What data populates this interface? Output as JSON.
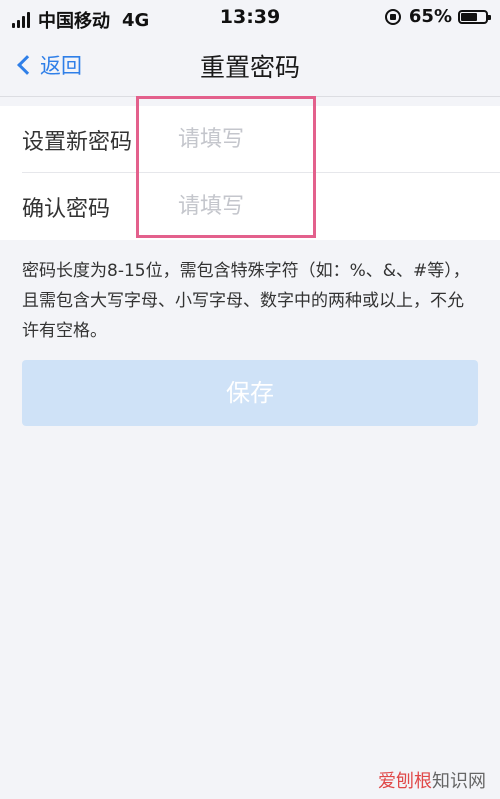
{
  "status_bar": {
    "carrier": "中国移动",
    "network": "4G",
    "time": "13:39",
    "battery_percent": "65%",
    "battery_level": 0.65,
    "rotation_icon": "rotation-lock-icon",
    "signal_icon": "signal-bars-icon"
  },
  "nav": {
    "back_label": "返回",
    "title": "重置密码",
    "back_icon": "chevron-left-icon"
  },
  "form": {
    "new_password": {
      "label": "设置新密码",
      "placeholder": "请填写",
      "value": ""
    },
    "confirm_password": {
      "label": "确认密码",
      "placeholder": "请填写",
      "value": ""
    }
  },
  "hint": "密码长度为8-15位，需包含特殊字符（如：%、&、#等），且需包含大写字母、小写字母、数字中的两种或以上，不允许有空格。",
  "save_label": "保存",
  "watermark": {
    "red_part": "爱刨根",
    "rest": "知识网"
  },
  "colors": {
    "accent": "#2f7fe8",
    "save_button_disabled": "#cfe2f7",
    "highlight": "#e3608c",
    "background": "#f3f4f8"
  }
}
